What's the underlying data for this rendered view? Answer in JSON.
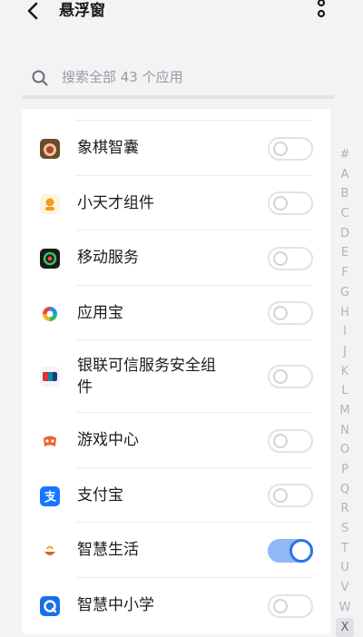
{
  "header": {
    "title": "悬浮窗",
    "back_icon": "chevron-left-icon",
    "more_icon": "more-vertical-icon"
  },
  "search": {
    "placeholder": "搜索全部 43 个应用",
    "icon": "search-icon"
  },
  "apps": [
    {
      "label": "象棋智囊",
      "icon": "chess-app-icon",
      "enabled": false
    },
    {
      "label": "小天才组件",
      "icon": "xiaotiancai-app-icon",
      "enabled": false
    },
    {
      "label": "移动服务",
      "icon": "mobile-services-app-icon",
      "enabled": false
    },
    {
      "label": "应用宝",
      "icon": "app-store-icon",
      "enabled": false
    },
    {
      "label": "银联可信服务安全组件",
      "icon": "unionpay-app-icon",
      "enabled": false
    },
    {
      "label": "游戏中心",
      "icon": "game-center-app-icon",
      "enabled": false
    },
    {
      "label": "支付宝",
      "icon": "alipay-app-icon",
      "enabled": false
    },
    {
      "label": "智慧生活",
      "icon": "smart-life-app-icon",
      "enabled": true
    },
    {
      "label": "智慧中小学",
      "icon": "smart-school-app-icon",
      "enabled": false
    }
  ],
  "alpha_index": [
    "#",
    "A",
    "B",
    "C",
    "D",
    "E",
    "F",
    "G",
    "H",
    "I",
    "J",
    "K",
    "L",
    "M",
    "N",
    "O",
    "P",
    "Q",
    "R",
    "S",
    "T",
    "U",
    "V",
    "W",
    "X"
  ],
  "alpha_active": "X",
  "colors": {
    "toggle_on_track": "#8fb8f4",
    "toggle_on_knob": "#2c74e9",
    "toggle_off_border": "#e2e2e6"
  }
}
